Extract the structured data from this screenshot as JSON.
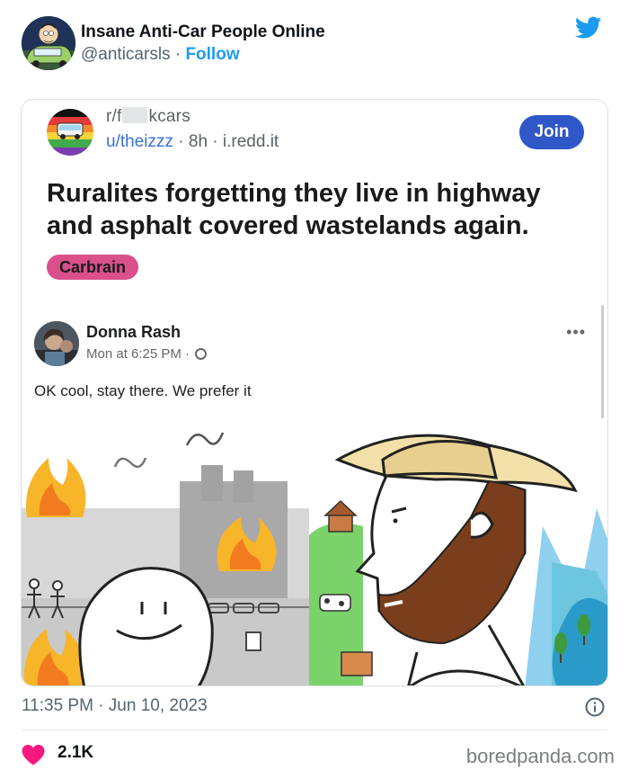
{
  "tweet": {
    "display_name": "Insane Anti-Car People Online",
    "handle": "@anticarsls",
    "separator": " · ",
    "follow_label": "Follow",
    "timestamp": "11:35 PM · Jun 10, 2023",
    "like_count": "2.1K",
    "icons": [
      "twitter-bird-icon",
      "info-icon",
      "heart-icon"
    ],
    "colors": {
      "accent": "#1d9bf0",
      "heart": "#f91880",
      "text": "#0f1419",
      "muted": "#536471"
    }
  },
  "reddit_post": {
    "subreddit_prefix": "r/",
    "subreddit_visible_start": "f",
    "subreddit_suffix": "kcars",
    "username": "u/theizzz",
    "age": "8h",
    "domain": "i.redd.it",
    "join_label": "Join",
    "title": "Ruralites forgetting they live in highway and asphalt covered wastelands again.",
    "flair": "Carbrain",
    "colors": {
      "join": "#2f57c7",
      "flair": "#d9508b",
      "user": "#3a6fd8"
    }
  },
  "facebook_post": {
    "author": "Donna Rash",
    "time": "Mon at 6:25 PM ·",
    "menu": "•••",
    "text": "OK cool, stay there. We prefer it"
  },
  "watermark": "boredpanda.com"
}
